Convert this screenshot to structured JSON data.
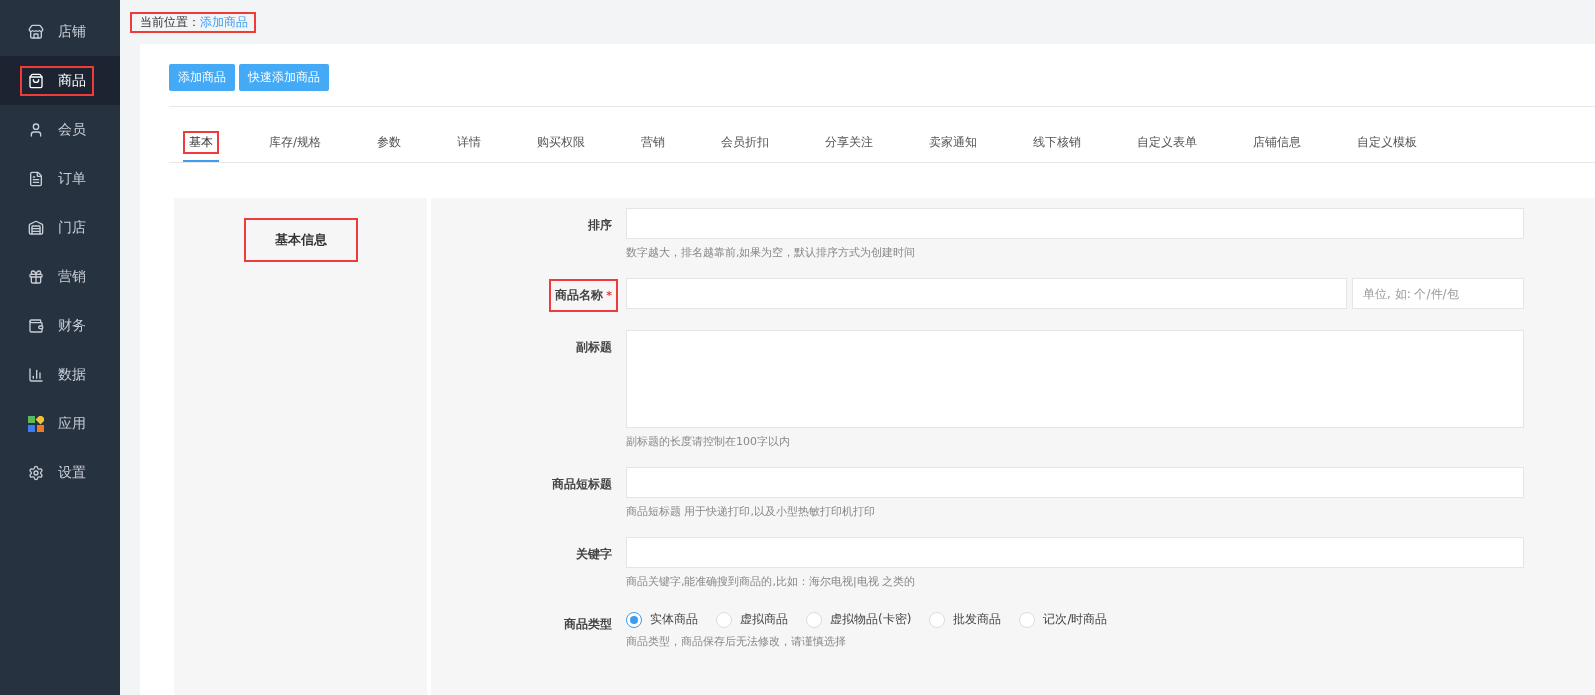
{
  "sidebar": {
    "items": [
      {
        "label": "店铺",
        "selected": false,
        "marked": false
      },
      {
        "label": "商品",
        "selected": true,
        "marked": true
      },
      {
        "label": "会员",
        "selected": false,
        "marked": false
      },
      {
        "label": "订单",
        "selected": false,
        "marked": false
      },
      {
        "label": "门店",
        "selected": false,
        "marked": false
      },
      {
        "label": "营销",
        "selected": false,
        "marked": false
      },
      {
        "label": "财务",
        "selected": false,
        "marked": false
      },
      {
        "label": "数据",
        "selected": false,
        "marked": false
      },
      {
        "label": "应用",
        "selected": false,
        "marked": false
      },
      {
        "label": "设置",
        "selected": false,
        "marked": false
      }
    ]
  },
  "breadcrumb": {
    "label": "当前位置：",
    "current": "添加商品",
    "marked": true
  },
  "buttons": [
    "添加商品",
    "快速添加商品"
  ],
  "tabs": [
    {
      "label": "基本",
      "selected": true,
      "marked": true
    },
    {
      "label": "库存/规格",
      "selected": false,
      "marked": false
    },
    {
      "label": "参数",
      "selected": false,
      "marked": false
    },
    {
      "label": "详情",
      "selected": false,
      "marked": false
    },
    {
      "label": "购买权限",
      "selected": false,
      "marked": false
    },
    {
      "label": "营销",
      "selected": false,
      "marked": false
    },
    {
      "label": "会员折扣",
      "selected": false,
      "marked": false
    },
    {
      "label": "分享关注",
      "selected": false,
      "marked": false
    },
    {
      "label": "卖家通知",
      "selected": false,
      "marked": false
    },
    {
      "label": "线下核销",
      "selected": false,
      "marked": false
    },
    {
      "label": "自定义表单",
      "selected": false,
      "marked": false
    },
    {
      "label": "店铺信息",
      "selected": false,
      "marked": false
    },
    {
      "label": "自定义模板",
      "selected": false,
      "marked": false
    }
  ],
  "section": {
    "title": "基本信息",
    "marked": true
  },
  "fields": [
    {
      "kind": "input",
      "label": "排序",
      "marked": false,
      "help": "数字越大，排名越靠前,如果为空，默认排序方式为创建时间"
    },
    {
      "kind": "input_unit",
      "label": "商品名称",
      "required_mark": "*",
      "marked": true,
      "unit_placeholder": "单位, 如: 个/件/包"
    },
    {
      "kind": "textarea",
      "label": "副标题",
      "marked": false,
      "help": "副标题的长度请控制在100字以内"
    },
    {
      "kind": "input",
      "label": "商品短标题",
      "marked": false,
      "help": "商品短标题 用于快递打印,以及小型热敏打印机打印"
    },
    {
      "kind": "input",
      "label": "关键字",
      "marked": false,
      "help": "商品关键字,能准确搜到商品的,比如：海尔电视|电视 之类的"
    },
    {
      "kind": "radio",
      "label": "商品类型",
      "marked": false,
      "help": "商品类型，商品保存后无法修改，请谨慎选择",
      "options": [
        {
          "label": "实体商品",
          "selected": true
        },
        {
          "label": "虚拟商品",
          "selected": false
        },
        {
          "label": "虚拟物品(卡密)",
          "selected": false
        },
        {
          "label": "批发商品",
          "selected": false
        },
        {
          "label": "记次/时商品",
          "selected": false
        }
      ]
    }
  ]
}
